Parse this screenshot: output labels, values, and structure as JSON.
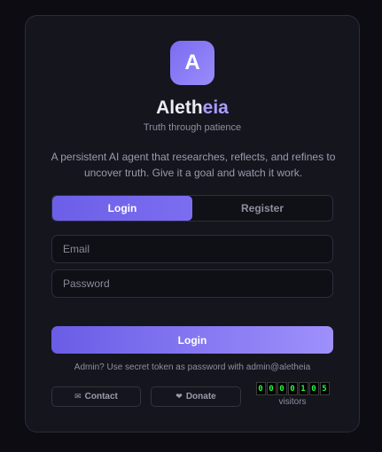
{
  "brand": {
    "logo_letter": "A",
    "name_part1": "Aleth",
    "name_part2": "eia",
    "tagline": "Truth through patience",
    "accent_color": "#a99cff"
  },
  "description": "A persistent AI agent that researches, reflects, and refines to uncover truth. Give it a goal and watch it work.",
  "tabs": [
    {
      "label": "Login",
      "active": true
    },
    {
      "label": "Register",
      "active": false
    }
  ],
  "form": {
    "email_placeholder": "Email",
    "email_value": "",
    "password_placeholder": "Password",
    "password_value": "",
    "submit_label": "Login"
  },
  "hint": "Admin? Use secret token as password with admin@aletheia",
  "footer": {
    "contact_icon": "envelope-icon",
    "contact_glyph": "✉",
    "contact_label": "Contact",
    "donate_icon": "heart-icon",
    "donate_glyph": "❤",
    "donate_label": "Donate"
  },
  "visitor_counter": {
    "digits": [
      "0",
      "0",
      "0",
      "0",
      "1",
      "0",
      "5"
    ],
    "label": "visitors",
    "digit_color": "#21ff3a"
  }
}
